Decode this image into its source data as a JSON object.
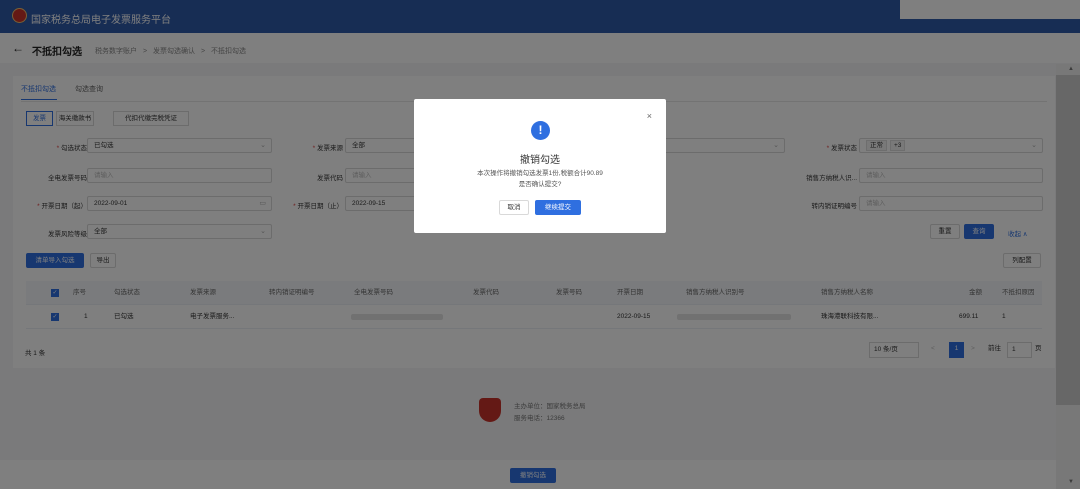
{
  "app": {
    "title": "国家税务总局电子发票服务平台"
  },
  "page": {
    "back_glyph": "←",
    "title": "不抵扣勾选",
    "breadcrumb": [
      "税务数字账户",
      ">",
      "发票勾选确认",
      ">",
      "不抵扣勾选"
    ]
  },
  "tabs": [
    "不抵扣勾选",
    "勾选查询"
  ],
  "segments": [
    "发票",
    "海关缴款书",
    "代扣代缴完税凭证"
  ],
  "filters": {
    "check_status_label": "勾选状态",
    "check_status_value": "已勾选",
    "source_label": "发票来源",
    "source_value": "全部",
    "invoice_status_label": "发票状态",
    "invoice_status_tag": "正常",
    "invoice_status_more": "+3",
    "einvoice_no_label": "全电发票号码",
    "einvoice_no_placeholder": "请输入",
    "invoice_code_label": "发票代码",
    "invoice_code_placeholder": "请输入",
    "seller_tax_id_label": "销售方纳税人识...",
    "seller_tax_id_placeholder": "请输入",
    "date_from_label": "开票日期（起）",
    "date_from_value": "2022-09-01",
    "date_to_label": "开票日期（止）",
    "date_to_value": "2022-09-15",
    "transfer_no_label": "转内销证明编号",
    "transfer_no_placeholder": "请输入",
    "risk_label": "发票风险等级",
    "risk_value": "全部"
  },
  "actions": {
    "reset": "重置",
    "query": "查询",
    "collapse": "收起 ∧",
    "batch_import": "清单导入勾选",
    "export": "导出",
    "column_config": "列配置"
  },
  "table": {
    "headers": [
      "序号",
      "勾选状态",
      "发票来源",
      "转内销证明编号",
      "全电发票号码",
      "发票代码",
      "发票号码",
      "开票日期",
      "销售方纳税人识别号",
      "销售方纳税人名称",
      "金额",
      "不抵扣原因"
    ],
    "row": {
      "index": "1",
      "status": "已勾选",
      "source": "电子发票服务...",
      "date": "2022-09-15",
      "seller_name": "珠海港联科技有限...",
      "amount": "699.11",
      "reason": "1"
    }
  },
  "pagination": {
    "total": "共 1 条",
    "page_size": "10 条/页",
    "prev": "<",
    "current": "1",
    "next": ">",
    "goto_label": "前往",
    "goto_value": "1",
    "page_suffix": "页"
  },
  "footer": {
    "org": "主办单位：国家税务总局",
    "hotline": "服务电话：12366"
  },
  "bottom_button": "撤销勾选",
  "dialog": {
    "close": "×",
    "icon": "!",
    "title": "撤销勾选",
    "message_line1": "本次操作将撤销勾选发票1份,税额合计90.89",
    "message_line2": "是否确认提交?",
    "cancel": "取消",
    "confirm": "继续提交"
  },
  "colors": {
    "brand": "#2f5aa8",
    "primary": "#2f6fe0",
    "danger": "#e03a3a"
  }
}
